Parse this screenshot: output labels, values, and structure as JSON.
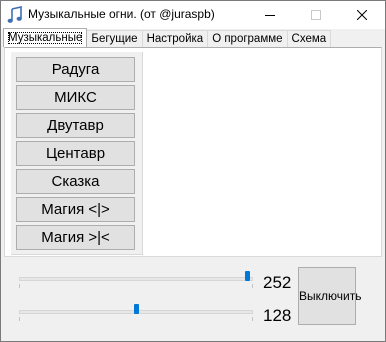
{
  "window": {
    "title": "Музыкальные огни. (от @juraspb)",
    "icon": "music-note-icon"
  },
  "tabs": [
    {
      "label": "Музыкальные",
      "active": true
    },
    {
      "label": "Бегущие",
      "active": false
    },
    {
      "label": "Настройка",
      "active": false
    },
    {
      "label": "О программе",
      "active": false
    },
    {
      "label": "Схема",
      "active": false
    }
  ],
  "modes": [
    {
      "label": "Радуга"
    },
    {
      "label": "МИКС"
    },
    {
      "label": "Двутавр"
    },
    {
      "label": "Центавр"
    },
    {
      "label": "Сказка"
    },
    {
      "label": "Магия <|>"
    },
    {
      "label": "Магия >|<"
    }
  ],
  "sliders": [
    {
      "value": "252",
      "level": 252,
      "max": 255
    },
    {
      "value": "128",
      "level": 128,
      "max": 255
    }
  ],
  "power_button": {
    "label": "Выключить"
  },
  "colors": {
    "accent": "#0078d7",
    "icon": "#3f6fb5"
  }
}
